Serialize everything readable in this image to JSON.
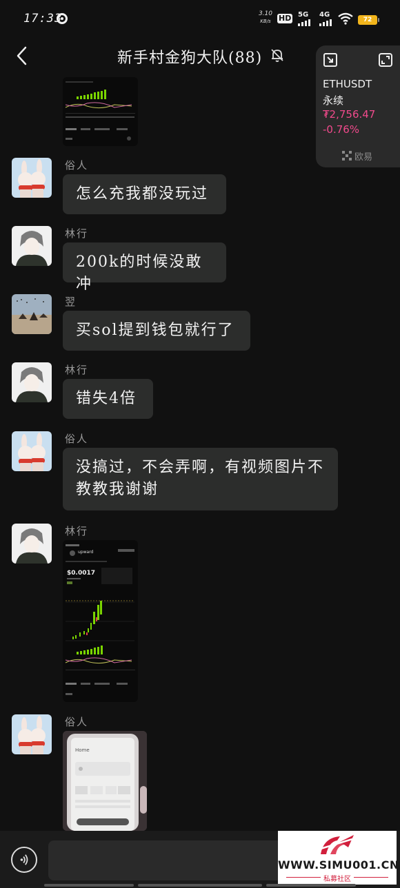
{
  "status_bar": {
    "time": "17:33",
    "net_speed": "3.10",
    "net_speed_unit": "KB/s",
    "hd_label": "HD",
    "sim1_gen": "5G",
    "sim2_gen": "4G",
    "battery_level": "72"
  },
  "header": {
    "title": "新手村金狗大队(88)"
  },
  "ticker_widget": {
    "symbol": "ETHUSDT",
    "contract_type": "永续",
    "price": "₮2,756.47",
    "change": "-0.76%",
    "brand": "欧易"
  },
  "messages": [
    {
      "sender": "俗人",
      "text": "怎么充我都没玩过"
    },
    {
      "sender": "林行",
      "text": "200k的时候没敢冲"
    },
    {
      "sender": "翌",
      "text": "买sol提到钱包就行了"
    },
    {
      "sender": "林行",
      "text": "错失4倍"
    },
    {
      "sender": "俗人",
      "text": "没搞过，不会弄啊，有视频图片不教教我谢谢"
    },
    {
      "sender": "林行",
      "image": {
        "token_name": "upward",
        "price": "$0.0017"
      }
    },
    {
      "sender": "俗人",
      "image": {
        "title": "Home"
      }
    }
  ],
  "watermark": {
    "site": "WWW.SIMU001.CN",
    "name": "私募社区"
  },
  "colors": {
    "background": "#111111",
    "bubble": "#2c2d2c",
    "price_negative": "#f14a8c",
    "chart_green": "#7ad400"
  }
}
